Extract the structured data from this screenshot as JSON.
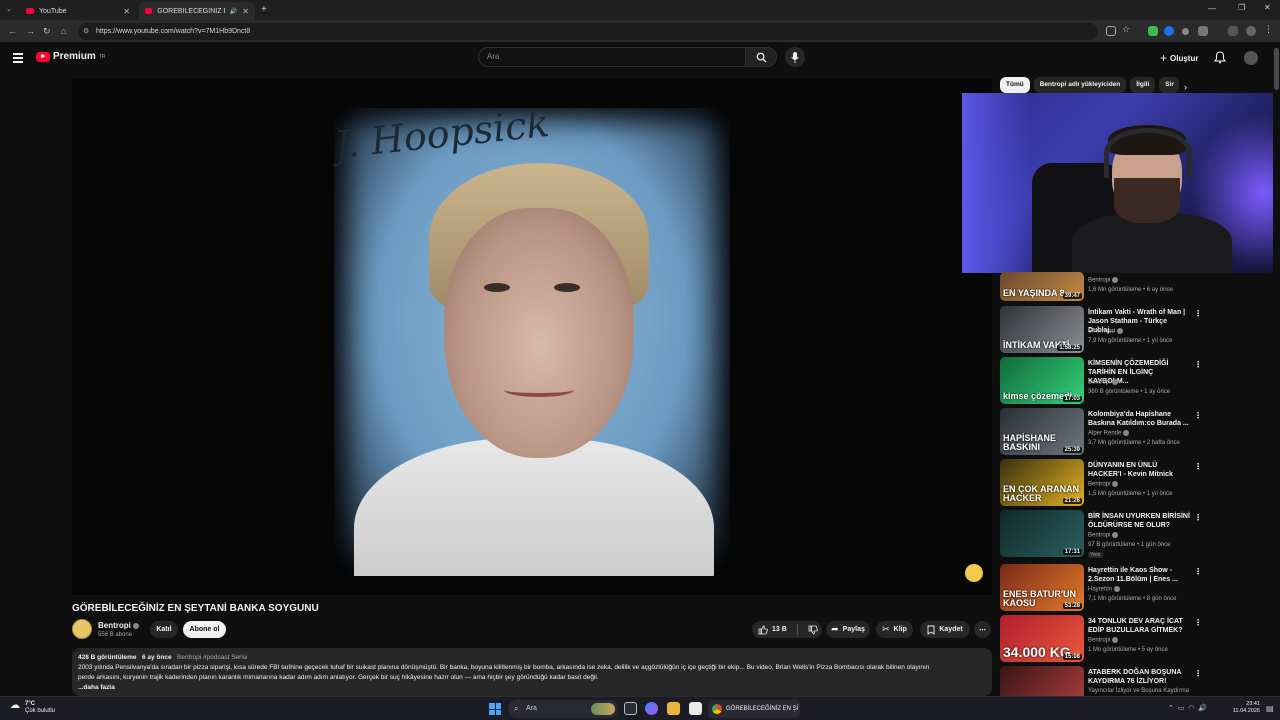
{
  "browser": {
    "tabs": [
      {
        "title": "YouTube"
      },
      {
        "title": "GÖREBİLECEĞİNİZ EN ŞEYTA"
      }
    ],
    "url": "https://www.youtube.com/watch?v=7M1Hb9Dnct8"
  },
  "header": {
    "logo_text": "Premium",
    "logo_badge": "TR",
    "search_placeholder": "Ara",
    "create_label": "Oluştur"
  },
  "video": {
    "mugshot_name": "J. Hoopsick",
    "title": "GÖREBİLECEĞİNİZ EN ŞEYTANİ BANKA SOYGUNU",
    "channel": "Bentropi",
    "subscribers": "556 B abone",
    "join_label": "Katıl",
    "subscribe_label": "Abone ol",
    "likes": "13 B",
    "share_label": "Paylaş",
    "clip_label": "Klip",
    "save_label": "Kaydet"
  },
  "description": {
    "views": "428 B görüntüleme",
    "age": "6 ay önce",
    "tags": "Bentropi  #podcast Serisi",
    "line1": "2003 yılında Pensilvanya'da sıradan bir pizza siparişi, kısa sürede FBI tarihine geçecek tuhaf bir suikast planına dönüşmüştü. Bir banka, boyuna kilitlenmiş bir bomba, arkasında ise zeka, delilik ve açgözlülüğün iç içe geçtiği bir ekip... Bu video, Brian Wells'in Pizza Bombacısı olarak bilinen olayının",
    "line2": "perde arkasını, kuryenin trajik kaderinden planın karanlık mimarlarına kadar adım adım anlatıyor. Gerçek bir suç hikâyesine hazır olun — ama hiçbir şey göründüğü kadar basit değil.",
    "more": "...daha fazla"
  },
  "chips": [
    "Tümü",
    "Bentropi adlı yükleyiciden",
    "İlgili",
    "Sir"
  ],
  "recommendations": [
    {
      "title": "",
      "channel": "Bentropi",
      "views": "1,6 Mn görüntüleme • 6 ay önce",
      "duration": "39:47",
      "overlay": "EN YAŞINDA 8",
      "colors": [
        "#6b4a2f",
        "#c48a45"
      ]
    },
    {
      "title": "İntikam Vakti - Wrath of Man | Jason Statham - Türkçe Dublaj...",
      "channel": "Sinemood",
      "views": "7,9 Mn görüntüleme • 1 yıl önce",
      "duration": "1:58:25",
      "overlay": "İNTİKAM VAKTİ",
      "colors": [
        "#2e3338",
        "#8a8f94"
      ]
    },
    {
      "title": "KİMSENİN ÇÖZEMEDİĞİ TARİHİN EN İLGİNÇ KAYBOLM...",
      "channel": "Bentropi",
      "views": "360 B görüntüleme • 1 ay önce",
      "duration": "17:03",
      "overlay": "kimse çözemedi",
      "colors": [
        "#0f6b3a",
        "#36d07a"
      ]
    },
    {
      "title": "Kolombiya'da Hapishane Baskına Katıldım:co Burada ...",
      "channel": "Alper Rende",
      "views": "3,7 Mn görüntüleme • 2 hafta önce",
      "duration": "25:39",
      "overlay": "HAPİSHANE BASKINI",
      "colors": [
        "#2b2f36",
        "#6e7680"
      ]
    },
    {
      "title": "DÜNYANIN EN ÜNLÜ HACKER'I - Kevin Mitnick",
      "channel": "Bentropi",
      "views": "1,5 Mn görüntüleme • 1 yıl önce",
      "duration": "21:26",
      "overlay": "EN ÇOK ARANAN HACKER",
      "colors": [
        "#3a3010",
        "#e0b020"
      ]
    },
    {
      "title": "BİR İNSAN UYURKEN BİRİSİNİ ÖLDÜRÜRSE NE OLUR?",
      "channel": "Bentropi",
      "views": "97 B görüntüleme • 1 gün önce",
      "duration": "17:31",
      "overlay": "",
      "badge": "Yeni",
      "colors": [
        "#0e2a2a",
        "#2e5f5f"
      ]
    },
    {
      "title": "Hayrettin ile Kaos Show - 2.Sezon 11.Bölüm | Enes ...",
      "channel": "Hayrettin",
      "views": "7,1 Mn görüntüleme • 8 gün önce",
      "duration": "53:28",
      "overlay": "ENES BATUR'UN KAOSU",
      "colors": [
        "#7a2a1a",
        "#e27a2a"
      ]
    },
    {
      "title": "34 TONLUK DEV ARAÇ İCAT EDİP BUZULLARA GİTMEK?",
      "channel": "Bentropi",
      "views": "1 Mn görüntüleme • 5 ay önce",
      "duration": "15:08",
      "overlay": "34.000 KG",
      "colors": [
        "#b01e2e",
        "#e95a3a"
      ]
    },
    {
      "title": "ATABERK DOĞAN BOŞUNA KAYDIRMA 76 İZLİYOR!",
      "channel": "Yayıncılar İzliyor ve Boşuna Kaydırma",
      "views": "",
      "duration": "",
      "overlay": "",
      "colors": [
        "#3a1414",
        "#b04040"
      ]
    }
  ],
  "taskbar": {
    "temp": "7°C",
    "weather": "Çok bulutlu",
    "search": "Ara",
    "chrome_title": "GÖREBİLECEĞİNİZ EN Şİ",
    "time": "23:41",
    "date": "11.04.2026"
  }
}
